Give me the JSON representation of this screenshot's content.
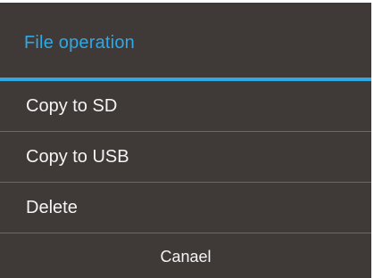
{
  "dialog": {
    "title": "File operation",
    "items": [
      {
        "label": "Copy to SD"
      },
      {
        "label": "Copy to USB"
      },
      {
        "label": "Delete"
      }
    ],
    "cancel_label": "Canael"
  },
  "colors": {
    "background": "#3f3a38",
    "accent": "#2ea9e8",
    "text": "#f4f4f4",
    "divider": "#6d6866"
  }
}
